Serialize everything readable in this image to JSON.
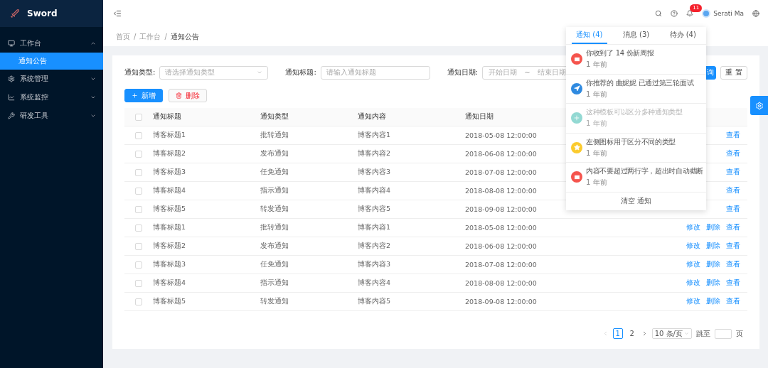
{
  "sidebar": {
    "logo": "Sword",
    "items": [
      {
        "label": "工作台",
        "kind": "monitor",
        "expanded": true,
        "children": [
          {
            "label": "通知公告",
            "selected": true
          }
        ]
      },
      {
        "label": "系统管理",
        "kind": "gear",
        "expanded": false
      },
      {
        "label": "系统监控",
        "kind": "chart",
        "expanded": false
      },
      {
        "label": "研发工具",
        "kind": "wrench",
        "expanded": false
      }
    ]
  },
  "header": {
    "badge": "11",
    "user": "Serati Ma"
  },
  "breadcrumb": {
    "separator": "/",
    "items": [
      "首页",
      "工作台",
      "通知公告"
    ]
  },
  "filters": {
    "type_label": "通知类型:",
    "type_placeholder": "请选择通知类型",
    "title_label": "通知标题:",
    "title_placeholder": "请输入通知标题",
    "date_label": "通知日期:",
    "date_start": "开始日期",
    "date_sep": "~",
    "date_end": "结束日期",
    "query": "询",
    "reset": "重 置"
  },
  "toolbar": {
    "add": "新增",
    "delete": "删除"
  },
  "table": {
    "header_checked": false,
    "columns": [
      "通知标题",
      "通知类型",
      "通知内容",
      "通知日期"
    ],
    "rows": [
      {
        "checked": false,
        "cells": [
          "博客标题1",
          "批转通知",
          "博客内容1",
          "2018-05-08 12:00:00"
        ],
        "actions": [
          "查看"
        ]
      },
      {
        "checked": false,
        "cells": [
          "博客标题2",
          "发布通知",
          "博客内容2",
          "2018-06-08 12:00:00"
        ],
        "actions": [
          "查看"
        ]
      },
      {
        "checked": false,
        "cells": [
          "博客标题3",
          "任免通知",
          "博客内容3",
          "2018-07-08 12:00:00"
        ],
        "actions": [
          "查看"
        ]
      },
      {
        "checked": false,
        "cells": [
          "博客标题4",
          "指示通知",
          "博客内容4",
          "2018-08-08 12:00:00"
        ],
        "actions": [
          "查看"
        ]
      },
      {
        "checked": false,
        "cells": [
          "博客标题5",
          "转发通知",
          "博客内容5",
          "2018-09-08 12:00:00"
        ],
        "actions": [
          "查看"
        ]
      },
      {
        "checked": false,
        "cells": [
          "博客标题1",
          "批转通知",
          "博客内容1",
          "2018-05-08 12:00:00"
        ],
        "actions": [
          "修改",
          "删除",
          "查看"
        ]
      },
      {
        "checked": false,
        "cells": [
          "博客标题2",
          "发布通知",
          "博客内容2",
          "2018-06-08 12:00:00"
        ],
        "actions": [
          "修改",
          "删除",
          "查看"
        ]
      },
      {
        "checked": false,
        "cells": [
          "博客标题3",
          "任免通知",
          "博客内容3",
          "2018-07-08 12:00:00"
        ],
        "actions": [
          "修改",
          "删除",
          "查看"
        ]
      },
      {
        "checked": false,
        "cells": [
          "博客标题4",
          "指示通知",
          "博客内容4",
          "2018-08-08 12:00:00"
        ],
        "actions": [
          "修改",
          "删除",
          "查看"
        ]
      },
      {
        "checked": false,
        "cells": [
          "博客标题5",
          "转发通知",
          "博客内容5",
          "2018-09-08 12:00:00"
        ],
        "actions": [
          "修改",
          "删除",
          "查看"
        ]
      }
    ]
  },
  "pagination": {
    "pages": [
      {
        "label": "1",
        "selected": true
      },
      {
        "label": "2",
        "selected": false
      }
    ],
    "page_size": "10 条/页",
    "jump_label": "跳至",
    "jump_suffix": "页"
  },
  "notifications": {
    "tabs": [
      {
        "label": "通知 (4)",
        "selected": true
      },
      {
        "label": "消息 (3)",
        "selected": false
      },
      {
        "label": "待办 (4)",
        "selected": false
      }
    ],
    "items": [
      {
        "kind": "mail",
        "color": "#f5544d",
        "text": "你收到了 14 份新周报",
        "time": "1 年前",
        "disabled": false
      },
      {
        "kind": "pointer",
        "color": "#2f8ae0",
        "text": "你推荐的 曲妮妮 已通过第三轮面试",
        "time": "1 年前",
        "disabled": false
      },
      {
        "kind": "plus",
        "color": "#93d9d3",
        "text": "这种模板可以区分多种通知类型",
        "time": "1 年前",
        "disabled": true
      },
      {
        "kind": "star",
        "color": "#fbcb2e",
        "text": "左侧图标用于区分不同的类型",
        "time": "1 年前",
        "disabled": false
      },
      {
        "kind": "mail",
        "color": "#f5544d",
        "text": "内容不要超过两行字，超出时自动截断",
        "time": "1 年前",
        "disabled": false
      }
    ],
    "footer": "清空 通知"
  }
}
